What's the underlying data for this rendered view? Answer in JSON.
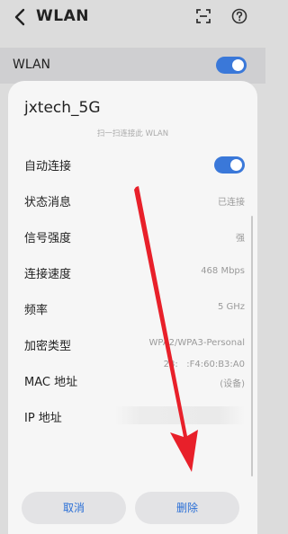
{
  "header": {
    "title": "WLAN"
  },
  "wlan_toggle": {
    "label": "WLAN",
    "on": true
  },
  "dialog": {
    "network_name": "jxtech_5G",
    "scan_hint": "扫一扫连接此 WLAN",
    "auto_connect": {
      "label": "自动连接",
      "on": true
    },
    "details": [
      {
        "label": "状态消息",
        "value": "已连接"
      },
      {
        "label": "信号强度",
        "value": "强"
      },
      {
        "label": "连接速度",
        "value": "468 Mbps"
      },
      {
        "label": "频率",
        "value": "5 GHz"
      },
      {
        "label": "加密类型",
        "value": "WPA2/WPA3-Personal"
      },
      {
        "label": "MAC 地址",
        "value": "28:   :F4:60:B3:A0",
        "value2": "(设备)"
      },
      {
        "label": "IP 地址",
        "value": ""
      }
    ],
    "buttons": {
      "cancel": "取消",
      "delete": "删除"
    }
  },
  "colors": {
    "accent": "#3a78d9",
    "annotation_arrow": "#e8202a"
  }
}
